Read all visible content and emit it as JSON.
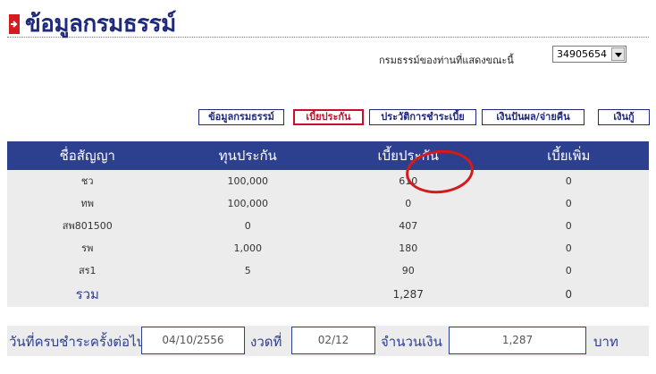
{
  "header": {
    "title": "ข้อมูลกรมธรรม์"
  },
  "policy_selector": {
    "label": "กรมธรรม์ของท่านที่แสดงขณะนี้",
    "selected": "34905654"
  },
  "tabs": [
    {
      "label": "ข้อมูลกรมธรรม์",
      "active": false
    },
    {
      "label": "เบี้ยประกัน",
      "active": true
    },
    {
      "label": "ประวัติการชำระเบี้ย",
      "active": false
    },
    {
      "label": "เงินปันผล/จ่ายคืน",
      "active": false
    },
    {
      "label": "เงินกู้",
      "active": false
    }
  ],
  "table": {
    "columns": [
      "ชื่อสัญญา",
      "ทุนประกัน",
      "เบี้ยประกัน",
      "เบี้ยเพิ่ม"
    ],
    "rows": [
      [
        "ชว",
        "100,000",
        "610",
        "0"
      ],
      [
        "ทพ",
        "100,000",
        "0",
        "0"
      ],
      [
        "สพ801500",
        "0",
        "407",
        "0"
      ],
      [
        "รพ",
        "1,000",
        "180",
        "0"
      ],
      [
        "สร1",
        "5",
        "90",
        "0"
      ]
    ],
    "total": {
      "label": "รวม",
      "sum_assured": "",
      "premium": "1,287",
      "extra": "0"
    }
  },
  "footer": {
    "due_label": "วันที่ครบชำระครั้งต่อไป",
    "due_date": "04/10/2556",
    "installment_label": "งวดที่",
    "installment": "02/12",
    "amount_label": "จำนวนเงิน",
    "amount": "1,287",
    "currency_label": "บาท"
  },
  "colors": {
    "title": "#1f2a7a",
    "header_bg": "#2d3f8f",
    "accent_red": "#d71920",
    "row_bg": "#ececec"
  }
}
